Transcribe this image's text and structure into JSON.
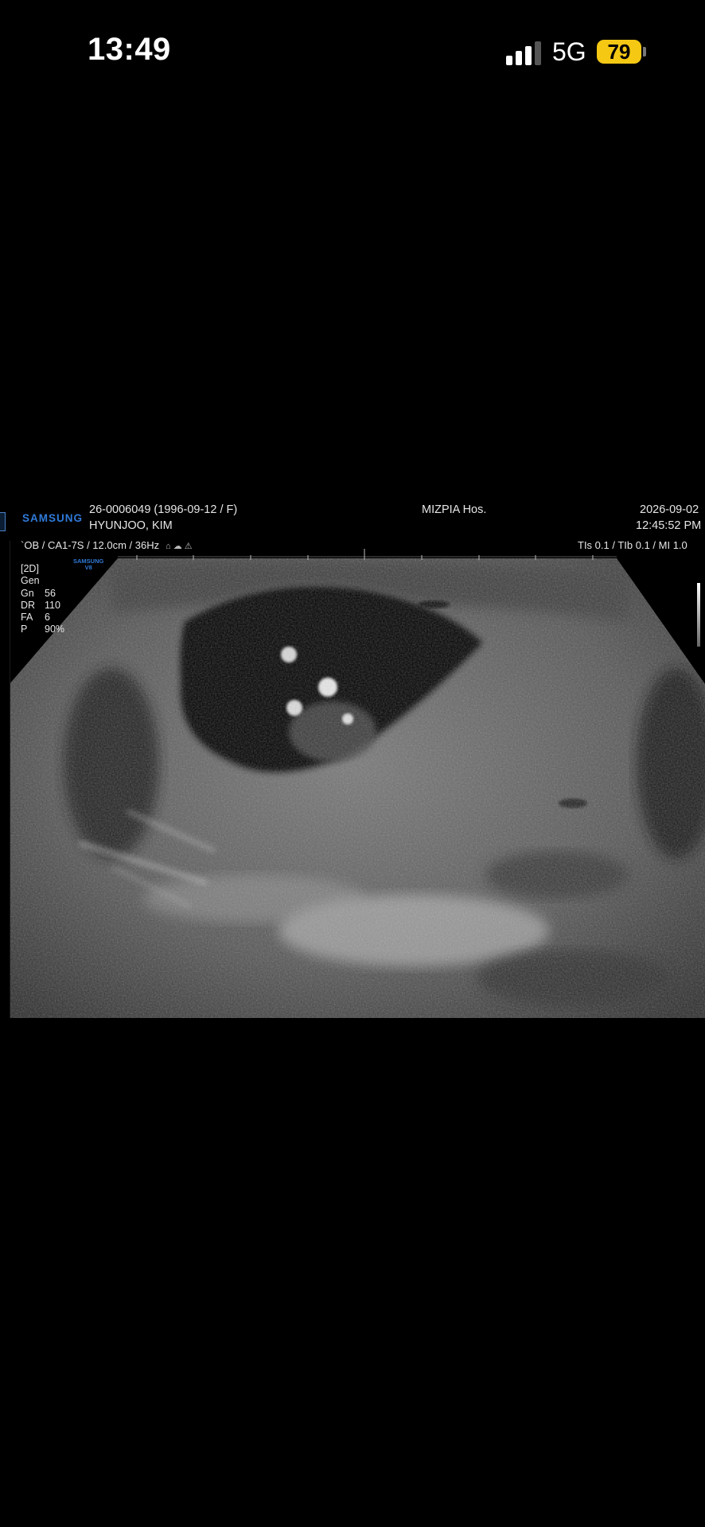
{
  "status_bar": {
    "time": "13:49",
    "network": "5G",
    "battery": "79",
    "signal_icon": "cellular-signal-icon"
  },
  "ultrasound": {
    "brand": "SAMSUNG",
    "brand_small": "SAMSUNG\nV8",
    "patient_id": "26-0006049 (1996-09-12 / F)",
    "patient_name": "HYUNJOO, KIM",
    "hospital": "MIZPIA Hos.",
    "date": "2026-09-02",
    "time": "12:45:52 PM",
    "probe_line": "`OB / CA1-7S / 12.0cm / 36Hz",
    "index_line": "TIs  0.1 / TIb  0.1 / MI   1.0",
    "mode": "[2D]",
    "preset": "Gen",
    "params": [
      {
        "label": "Gn",
        "value": "56"
      },
      {
        "label": "DR",
        "value": "110"
      },
      {
        "label": "FA",
        "value": "6"
      },
      {
        "label": "P",
        "value": "90%"
      }
    ]
  }
}
